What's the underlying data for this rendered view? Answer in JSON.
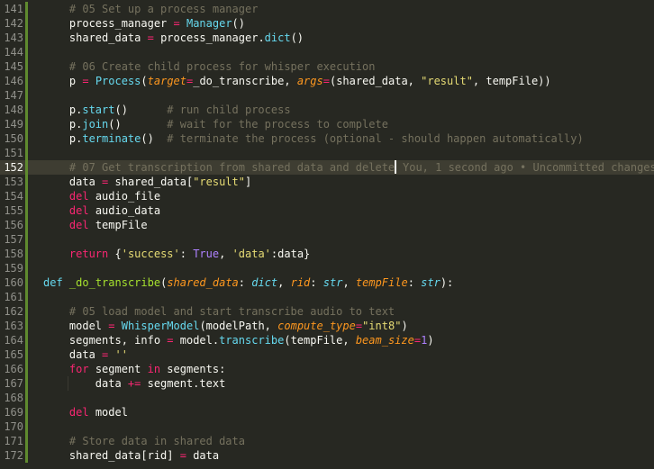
{
  "editor": {
    "current_line": 152,
    "blame_text": "You, 1 second ago • Uncommitted changes",
    "git_marks": [
      141,
      142,
      143,
      144,
      145,
      146,
      147,
      148,
      149,
      150,
      151,
      152,
      153,
      154,
      155,
      156,
      157,
      158,
      159,
      160,
      161,
      162,
      163,
      164,
      165,
      166,
      167,
      168,
      169,
      170,
      171,
      172
    ],
    "lines": [
      {
        "num": 141,
        "indent": 1,
        "tokens": [
          {
            "t": "# 05 Set up a process manager",
            "c": "cm"
          }
        ]
      },
      {
        "num": 142,
        "indent": 1,
        "tokens": [
          {
            "t": "process_manager ",
            "c": "tx"
          },
          {
            "t": "=",
            "c": "op"
          },
          {
            "t": " ",
            "c": "tx"
          },
          {
            "t": "Manager",
            "c": "fn"
          },
          {
            "t": "()",
            "c": "tx"
          }
        ]
      },
      {
        "num": 143,
        "indent": 1,
        "tokens": [
          {
            "t": "shared_data ",
            "c": "tx"
          },
          {
            "t": "=",
            "c": "op"
          },
          {
            "t": " process_manager.",
            "c": "tx"
          },
          {
            "t": "dict",
            "c": "fn"
          },
          {
            "t": "()",
            "c": "tx"
          }
        ]
      },
      {
        "num": 144,
        "indent": 0,
        "tokens": []
      },
      {
        "num": 145,
        "indent": 1,
        "tokens": [
          {
            "t": "# 06 Create child process for whisper execution",
            "c": "cm"
          }
        ]
      },
      {
        "num": 146,
        "indent": 1,
        "tokens": [
          {
            "t": "p ",
            "c": "tx"
          },
          {
            "t": "=",
            "c": "op"
          },
          {
            "t": " ",
            "c": "tx"
          },
          {
            "t": "Process",
            "c": "fn"
          },
          {
            "t": "(",
            "c": "tx"
          },
          {
            "t": "target",
            "c": "pa"
          },
          {
            "t": "=",
            "c": "op"
          },
          {
            "t": "_do_transcribe, ",
            "c": "tx"
          },
          {
            "t": "args",
            "c": "pa"
          },
          {
            "t": "=",
            "c": "op"
          },
          {
            "t": "(shared_data, ",
            "c": "tx"
          },
          {
            "t": "\"result\"",
            "c": "st"
          },
          {
            "t": ", tempFile))",
            "c": "tx"
          }
        ]
      },
      {
        "num": 147,
        "indent": 0,
        "tokens": []
      },
      {
        "num": 148,
        "indent": 1,
        "tokens": [
          {
            "t": "p.",
            "c": "tx"
          },
          {
            "t": "start",
            "c": "fn"
          },
          {
            "t": "()      ",
            "c": "tx"
          },
          {
            "t": "# run child process",
            "c": "cm"
          }
        ]
      },
      {
        "num": 149,
        "indent": 1,
        "tokens": [
          {
            "t": "p.",
            "c": "tx"
          },
          {
            "t": "join",
            "c": "fn"
          },
          {
            "t": "()       ",
            "c": "tx"
          },
          {
            "t": "# wait for the process to complete",
            "c": "cm"
          }
        ]
      },
      {
        "num": 150,
        "indent": 1,
        "tokens": [
          {
            "t": "p.",
            "c": "tx"
          },
          {
            "t": "terminate",
            "c": "fn"
          },
          {
            "t": "()  ",
            "c": "tx"
          },
          {
            "t": "# terminate the process (optional - should happen automatically)",
            "c": "cm"
          }
        ]
      },
      {
        "num": 151,
        "indent": 0,
        "tokens": []
      },
      {
        "num": 152,
        "indent": 1,
        "tokens": [
          {
            "t": "# 07 Get transcription from shared data and delete",
            "c": "cm"
          }
        ],
        "cursor": true,
        "blame": true
      },
      {
        "num": 153,
        "indent": 1,
        "tokens": [
          {
            "t": "data ",
            "c": "tx"
          },
          {
            "t": "=",
            "c": "op"
          },
          {
            "t": " shared_data[",
            "c": "tx"
          },
          {
            "t": "\"result\"",
            "c": "st"
          },
          {
            "t": "]",
            "c": "tx"
          }
        ]
      },
      {
        "num": 154,
        "indent": 1,
        "tokens": [
          {
            "t": "del",
            "c": "kw"
          },
          {
            "t": " audio_file",
            "c": "tx"
          }
        ]
      },
      {
        "num": 155,
        "indent": 1,
        "tokens": [
          {
            "t": "del",
            "c": "kw"
          },
          {
            "t": " audio_data",
            "c": "tx"
          }
        ]
      },
      {
        "num": 156,
        "indent": 1,
        "tokens": [
          {
            "t": "del",
            "c": "kw"
          },
          {
            "t": " tempFile",
            "c": "tx"
          }
        ]
      },
      {
        "num": 157,
        "indent": 0,
        "tokens": []
      },
      {
        "num": 158,
        "indent": 1,
        "tokens": [
          {
            "t": "return",
            "c": "kw"
          },
          {
            "t": " {",
            "c": "tx"
          },
          {
            "t": "'success'",
            "c": "st"
          },
          {
            "t": ": ",
            "c": "tx"
          },
          {
            "t": "True",
            "c": "nu"
          },
          {
            "t": ", ",
            "c": "tx"
          },
          {
            "t": "'data'",
            "c": "st"
          },
          {
            "t": ":data}",
            "c": "tx"
          }
        ]
      },
      {
        "num": 159,
        "indent": 0,
        "tokens": []
      },
      {
        "num": 160,
        "indent": 0,
        "tokens": [
          {
            "t": "def",
            "c": "fn"
          },
          {
            "t": " ",
            "c": "tx"
          },
          {
            "t": "_do_transcribe",
            "c": "df"
          },
          {
            "t": "(",
            "c": "tx"
          },
          {
            "t": "shared_data",
            "c": "pa"
          },
          {
            "t": ": ",
            "c": "tx"
          },
          {
            "t": "dict",
            "c": "ty"
          },
          {
            "t": ", ",
            "c": "tx"
          },
          {
            "t": "rid",
            "c": "pa"
          },
          {
            "t": ": ",
            "c": "tx"
          },
          {
            "t": "str",
            "c": "ty"
          },
          {
            "t": ", ",
            "c": "tx"
          },
          {
            "t": "tempFile",
            "c": "pa"
          },
          {
            "t": ": ",
            "c": "tx"
          },
          {
            "t": "str",
            "c": "ty"
          },
          {
            "t": "):",
            "c": "tx"
          }
        ]
      },
      {
        "num": 161,
        "indent": 0,
        "tokens": []
      },
      {
        "num": 162,
        "indent": 1,
        "tokens": [
          {
            "t": "# 05 load model and start transcribe audio to text",
            "c": "cm"
          }
        ]
      },
      {
        "num": 163,
        "indent": 1,
        "tokens": [
          {
            "t": "model ",
            "c": "tx"
          },
          {
            "t": "=",
            "c": "op"
          },
          {
            "t": " ",
            "c": "tx"
          },
          {
            "t": "WhisperModel",
            "c": "fn"
          },
          {
            "t": "(modelPath, ",
            "c": "tx"
          },
          {
            "t": "compute_type",
            "c": "pa"
          },
          {
            "t": "=",
            "c": "op"
          },
          {
            "t": "\"int8\"",
            "c": "st"
          },
          {
            "t": ")",
            "c": "tx"
          }
        ]
      },
      {
        "num": 164,
        "indent": 1,
        "tokens": [
          {
            "t": "segments, info ",
            "c": "tx"
          },
          {
            "t": "=",
            "c": "op"
          },
          {
            "t": " model.",
            "c": "tx"
          },
          {
            "t": "transcribe",
            "c": "fn"
          },
          {
            "t": "(tempFile, ",
            "c": "tx"
          },
          {
            "t": "beam_size",
            "c": "pa"
          },
          {
            "t": "=",
            "c": "op"
          },
          {
            "t": "1",
            "c": "nu"
          },
          {
            "t": ")",
            "c": "tx"
          }
        ]
      },
      {
        "num": 165,
        "indent": 1,
        "tokens": [
          {
            "t": "data ",
            "c": "tx"
          },
          {
            "t": "=",
            "c": "op"
          },
          {
            "t": " ",
            "c": "tx"
          },
          {
            "t": "''",
            "c": "st"
          }
        ]
      },
      {
        "num": 166,
        "indent": 1,
        "tokens": [
          {
            "t": "for",
            "c": "kw"
          },
          {
            "t": " segment ",
            "c": "tx"
          },
          {
            "t": "in",
            "c": "kw"
          },
          {
            "t": " segments:",
            "c": "tx"
          }
        ]
      },
      {
        "num": 167,
        "indent": 2,
        "tokens": [
          {
            "t": "data ",
            "c": "tx"
          },
          {
            "t": "+=",
            "c": "op"
          },
          {
            "t": " segment.text",
            "c": "tx"
          }
        ]
      },
      {
        "num": 168,
        "indent": 0,
        "tokens": []
      },
      {
        "num": 169,
        "indent": 1,
        "tokens": [
          {
            "t": "del",
            "c": "kw"
          },
          {
            "t": " model",
            "c": "tx"
          }
        ]
      },
      {
        "num": 170,
        "indent": 0,
        "tokens": []
      },
      {
        "num": 171,
        "indent": 1,
        "tokens": [
          {
            "t": "# Store data in shared data",
            "c": "cm"
          }
        ]
      },
      {
        "num": 172,
        "indent": 1,
        "tokens": [
          {
            "t": "shared_data[rid] ",
            "c": "tx"
          },
          {
            "t": "=",
            "c": "op"
          },
          {
            "t": " data",
            "c": "tx"
          }
        ]
      }
    ]
  }
}
